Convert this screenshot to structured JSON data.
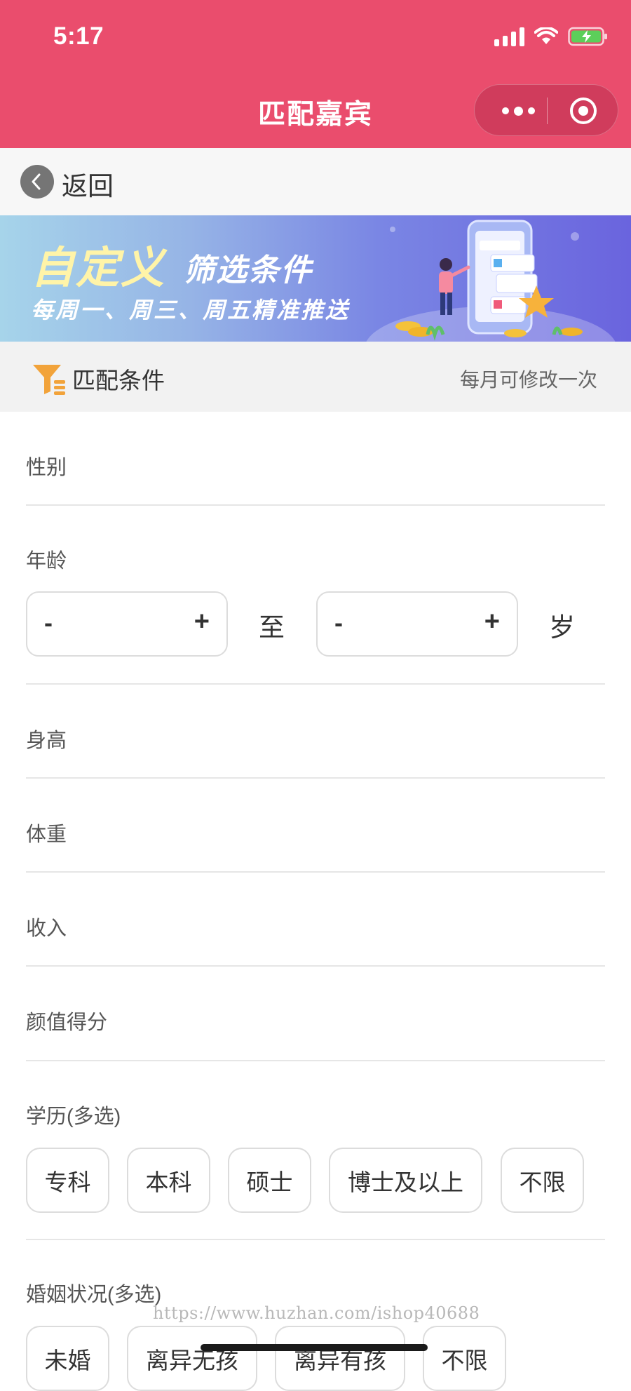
{
  "status_bar": {
    "time": "5:17"
  },
  "nav": {
    "title": "匹配嘉宾",
    "more_icon": "more-dots-icon",
    "close_icon": "target-circle-icon"
  },
  "back": {
    "label": "返回"
  },
  "banner": {
    "title_main": "自定义",
    "title_secondary": "筛选条件",
    "subtitle": "每周一、周三、周五精准推送"
  },
  "conditions": {
    "title": "匹配条件",
    "note": "每月可修改一次"
  },
  "form": {
    "gender_label": "性别",
    "age": {
      "label": "年龄",
      "min_value": "",
      "max_value": "",
      "minus": "-",
      "plus": "+",
      "to": "至",
      "unit": "岁"
    },
    "height_label": "身高",
    "weight_label": "体重",
    "income_label": "收入",
    "looks_label": "颜值得分",
    "education": {
      "label": "学历(多选)",
      "options": [
        "专科",
        "本科",
        "硕士",
        "博士及以上",
        "不限"
      ]
    },
    "marital": {
      "label": "婚姻状况(多选)",
      "options": [
        "未婚",
        "离异无孩",
        "离异有孩",
        "不限"
      ]
    }
  },
  "watermark": "https://www.huzhan.com/ishop40688",
  "colors": {
    "brand": "#ea4d6d",
    "banner_start": "#a6d4ea",
    "banner_end": "#6a64de",
    "filter_icon": "#f2a33a"
  }
}
